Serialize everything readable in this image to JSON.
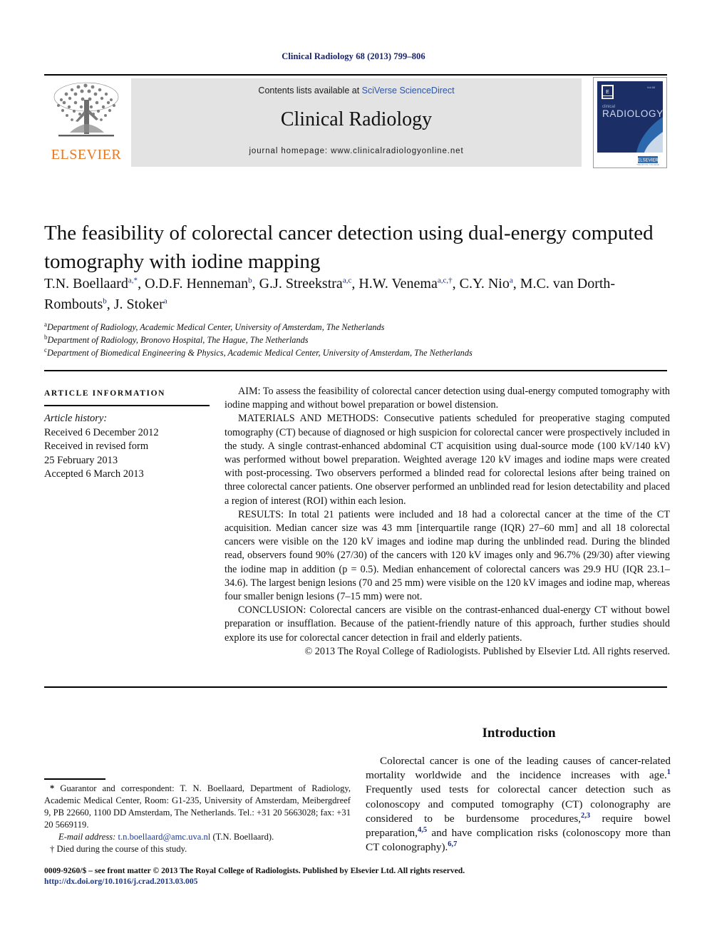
{
  "running_head": "Clinical Radiology 68 (2013) 799–806",
  "masthead": {
    "publisher_logo_name": "elsevier-tree-logo",
    "publisher_name": "ELSEVIER",
    "contents_prefix": "Contents lists available at ",
    "contents_link": "SciVerse ScienceDirect",
    "journal_title": "Clinical Radiology",
    "homepage": "journal homepage: www.clinicalradiologyonline.net",
    "cover": {
      "small_word": "clinical",
      "big_word": "RADIOLOGY",
      "publisher_mark": "ELSEVIER"
    }
  },
  "article": {
    "title": "The feasibility of colorectal cancer detection using dual-energy computed tomography with iodine mapping",
    "authors_html": "T.N. Boellaard<sup>a,&#42;</sup>, O.D.F. Henneman<sup>b</sup>, G.J. Streekstra<sup>a,c</sup>, H.W. Venema<sup>a,c,†</sup>, C.Y. Nio<sup>a</sup>, M.C. van Dorth-Rombouts<sup>b</sup>, J. Stoker<sup>a</sup>",
    "affiliations": [
      {
        "marker": "a",
        "text": "Department of Radiology, Academic Medical Center, University of Amsterdam, The Netherlands"
      },
      {
        "marker": "b",
        "text": "Department of Radiology, Bronovo Hospital, The Hague, The Netherlands"
      },
      {
        "marker": "c",
        "text": "Department of Biomedical Engineering & Physics, Academic Medical Center, University of Amsterdam, The Netherlands"
      }
    ]
  },
  "article_information": {
    "heading": "ARTICLE INFORMATION",
    "history_label": "Article history:",
    "history": [
      "Received 6 December 2012",
      "Received in revised form",
      "25 February 2013",
      "Accepted 6 March 2013"
    ]
  },
  "abstract": {
    "aim_label": "AIM:",
    "aim_text": " To assess the feasibility of colorectal cancer detection using dual-energy computed tomography with iodine mapping and without bowel preparation or bowel distension.",
    "methods_label": "MATERIALS AND METHODS:",
    "methods_text": " Consecutive patients scheduled for preoperative staging computed tomography (CT) because of diagnosed or high suspicion for colorectal cancer were prospectively included in the study. A single contrast-enhanced abdominal CT acquisition using dual-source mode (100 kV/140 kV) was performed without bowel preparation. Weighted average 120 kV images and iodine maps were created with post-processing. Two observers performed a blinded read for colorectal lesions after being trained on three colorectal cancer patients. One observer performed an unblinded read for lesion detectability and placed a region of interest (ROI) within each lesion.",
    "results_label": "RESULTS:",
    "results_text": " In total 21 patients were included and 18 had a colorectal cancer at the time of the CT acquisition. Median cancer size was 43 mm [interquartile range (IQR) 27–60 mm] and all 18 colorectal cancers were visible on the 120 kV images and iodine map during the unblinded read. During the blinded read, observers found 90% (27/30) of the cancers with 120 kV images only and 96.7% (29/30) after viewing the iodine map in addition (p = 0.5). Median enhancement of colorectal cancers was 29.9 HU (IQR 23.1–34.6). The largest benign lesions (70 and 25 mm) were visible on the 120 kV images and iodine map, whereas four smaller benign lesions (7–15 mm) were not.",
    "conclusion_label": "CONCLUSION:",
    "conclusion_text": " Colorectal cancers are visible on the contrast-enhanced dual-energy CT without bowel preparation or insufflation. Because of the patient-friendly nature of this approach, further studies should explore its use for colorectal cancer detection in frail and elderly patients.",
    "copyright": "© 2013 The Royal College of Radiologists. Published by Elsevier Ltd. All rights reserved."
  },
  "body": {
    "section_heading": "Introduction",
    "paragraph_html": "Colorectal cancer is one of the leading causes of cancer-related mortality worldwide and the incidence increases with age.<sup>1</sup> Frequently used tests for colorectal cancer detection such as colonoscopy and computed tomography (CT) colonography are considered to be burdensome procedures,<sup>2,3</sup> require bowel preparation,<sup>4,5</sup> and have complication risks (colonoscopy more than CT colonography).<sup>6,7</sup>"
  },
  "footnotes": {
    "corresponding_html": "<b>&#42;</b> Guarantor and correspondent: T. N. Boellaard, Department of Radiology, Academic Medical Center, Room: G1-235, University of Amsterdam, Meibergdreef 9, PB 22660, 1100 DD Amsterdam, The Netherlands. Tel.: +31 20 5663028; fax: +31 20 5669119.",
    "email_label": "E-mail address:",
    "email_value": "t.n.boellaard@amc.uva.nl",
    "email_suffix": " (T.N. Boellaard).",
    "died_note": "† Died during the course of this study."
  },
  "bottom": {
    "frontmatter": "0009-9260/$ – see front matter © 2013 The Royal College of Radiologists. Published by Elsevier Ltd. All rights reserved.",
    "doi": "http://dx.doi.org/10.1016/j.crad.2013.03.005"
  },
  "colors": {
    "running_head": "#18216b",
    "link": "#2b55a6",
    "elsevier_orange": "#e87722",
    "band_grey": "#e3e3e3",
    "cover_navy": "#1b2f66"
  }
}
